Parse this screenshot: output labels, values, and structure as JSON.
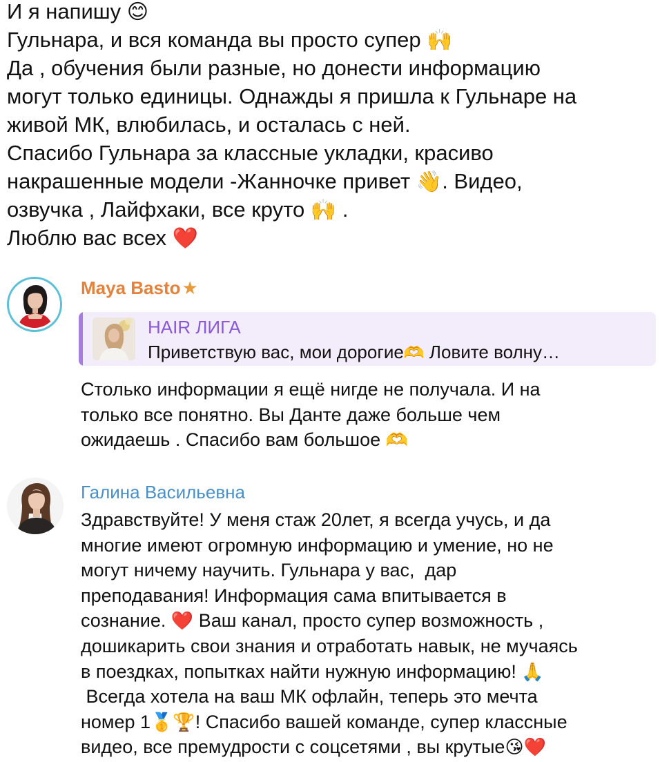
{
  "top_message": {
    "lines": [
      {
        "text": "И я напишу ",
        "emoji": "😊"
      },
      {
        "text": "Гульнара, и вся команда вы просто супер ",
        "emoji": "🙌"
      },
      {
        "text": "Да , обучения были разные, но донести информацию",
        "emoji": ""
      },
      {
        "text": "могут только единицы. Однажды я пришла к Гульнаре на",
        "emoji": ""
      },
      {
        "text": "живой МК, влюбилась, и осталась с ней.",
        "emoji": ""
      },
      {
        "text": "Спасибо Гульнара за классные укладки, красиво",
        "emoji": ""
      },
      {
        "text": "накрашенные модели -Жанночке привет ",
        "emoji": "👋",
        "after": ". Видео,"
      },
      {
        "text": "озвучка , Лайфхаки, все круто ",
        "emoji": "🙌",
        "after": " ."
      },
      {
        "text": "Люблю вас всех ",
        "emoji": "❤️"
      }
    ]
  },
  "comments": [
    {
      "sender": "Maya Basto",
      "badge_icon": "star-icon",
      "avatar_icon": "avatar-photo",
      "reply": {
        "title": "HAIR ЛИГА",
        "text": "Приветствую вас, мои дорогие",
        "emoji": "🫶",
        "after": " Ловите волну…"
      },
      "lines": [
        {
          "text": "Столько информации я ещё нигде не получала. И на",
          "emoji": ""
        },
        {
          "text": "только все понятно. Вы Данте даже больше чем",
          "emoji": ""
        },
        {
          "text": "ожидаешь . Спасибо вам большое ",
          "emoji": "🫶"
        }
      ]
    },
    {
      "sender": "Галина Васильевна",
      "avatar_icon": "avatar-photo",
      "lines": [
        {
          "text": "Здравствуйте! У меня стаж 20лет, я всегда учусь, и да",
          "emoji": ""
        },
        {
          "text": "многие имеют огромную информацию и умение, но не",
          "emoji": ""
        },
        {
          "text": "могут ничему научить. Гульнара у вас,  дар",
          "emoji": ""
        },
        {
          "text": "преподавания! Информация сама впитывается в",
          "emoji": ""
        },
        {
          "text": "сознание. ",
          "emoji": "❤️",
          "after": " Ваш канал, просто супер возможность ,"
        },
        {
          "text": "дошикарить свои знания и отработать навык, не мучаясь",
          "emoji": ""
        },
        {
          "text": "в поездках, попытках найти нужную информацию! ",
          "emoji": "🙏"
        },
        {
          "text": " Всегда хотела на ваш МК офлайн, теперь это мечта",
          "emoji": ""
        },
        {
          "text": "номер 1",
          "emoji": "🥇🏆",
          "after": "! Спасибо вашей команде, супер классные"
        },
        {
          "text": "видео, все премудрости с соцсетями , вы крутые",
          "emoji": "😘❤️"
        }
      ]
    }
  ],
  "colors": {
    "sender_maya": "#e4813a",
    "sender_galina": "#4a90c8",
    "reply_accent": "#a67ee0",
    "reply_bg": "#f3ecfb"
  }
}
